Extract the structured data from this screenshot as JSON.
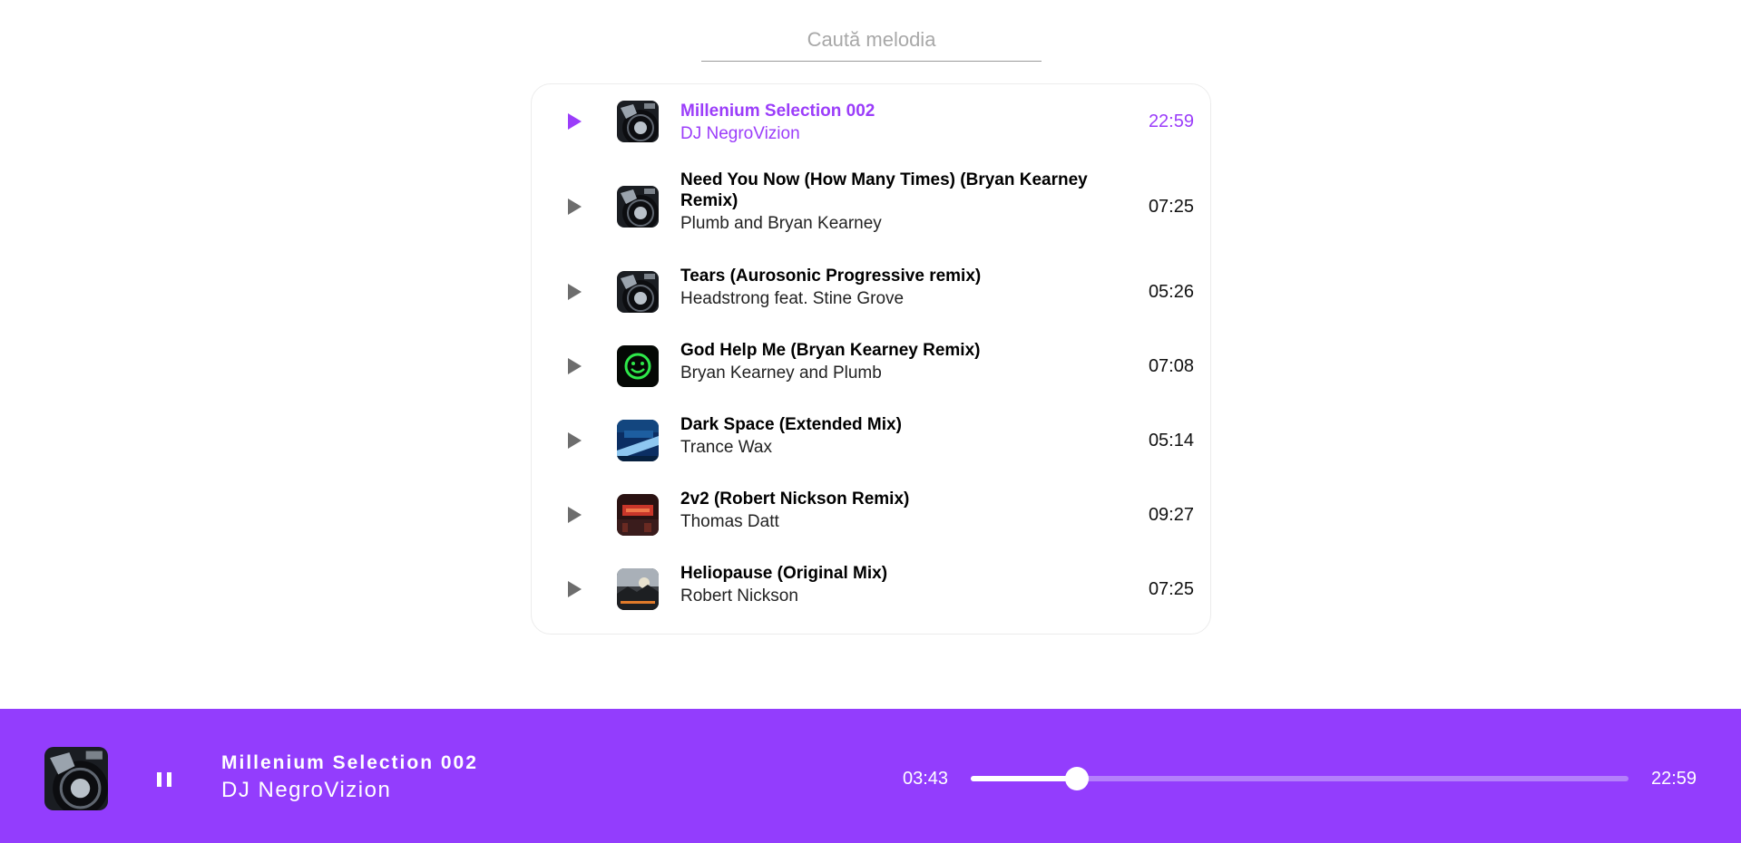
{
  "search": {
    "placeholder": "Caută melodia",
    "value": ""
  },
  "accent_color": "#9b3dfa",
  "player_bg_color": "#933dfd",
  "tracks": [
    {
      "title": "Millenium Selection 002",
      "artist": "DJ NegroVizion",
      "duration": "22:59",
      "active": true,
      "cover": "turntable-cover"
    },
    {
      "title": "Need You Now (How Many Times) (Bryan Kearney Remix)",
      "artist": "Plumb and Bryan Kearney",
      "duration": "07:25",
      "active": false,
      "cover": "turntable-cover"
    },
    {
      "title": "Tears (Aurosonic Progressive remix)",
      "artist": "Headstrong feat. Stine Grove",
      "duration": "05:26",
      "active": false,
      "cover": "turntable-cover"
    },
    {
      "title": "God Help Me (Bryan Kearney Remix)",
      "artist": "Bryan Kearney and Plumb",
      "duration": "07:08",
      "active": false,
      "cover": "green-smiley-cover"
    },
    {
      "title": "Dark Space (Extended Mix)",
      "artist": "Trance Wax",
      "duration": "05:14",
      "active": false,
      "cover": "blue-tunnel-cover"
    },
    {
      "title": "2v2 (Robert Nickson Remix)",
      "artist": "Thomas Datt",
      "duration": "09:27",
      "active": false,
      "cover": "red-city-cover"
    },
    {
      "title": "Heliopause (Original Mix)",
      "artist": "Robert Nickson",
      "duration": "07:25",
      "active": false,
      "cover": "sky-landscape-cover"
    }
  ],
  "player": {
    "title": "Millenium Selection 002",
    "artist": "DJ NegroVizion",
    "current_time": "03:43",
    "total_time": "22:59",
    "progress_fraction": 0.162,
    "state": "playing",
    "control_icon": "pause-icon"
  }
}
